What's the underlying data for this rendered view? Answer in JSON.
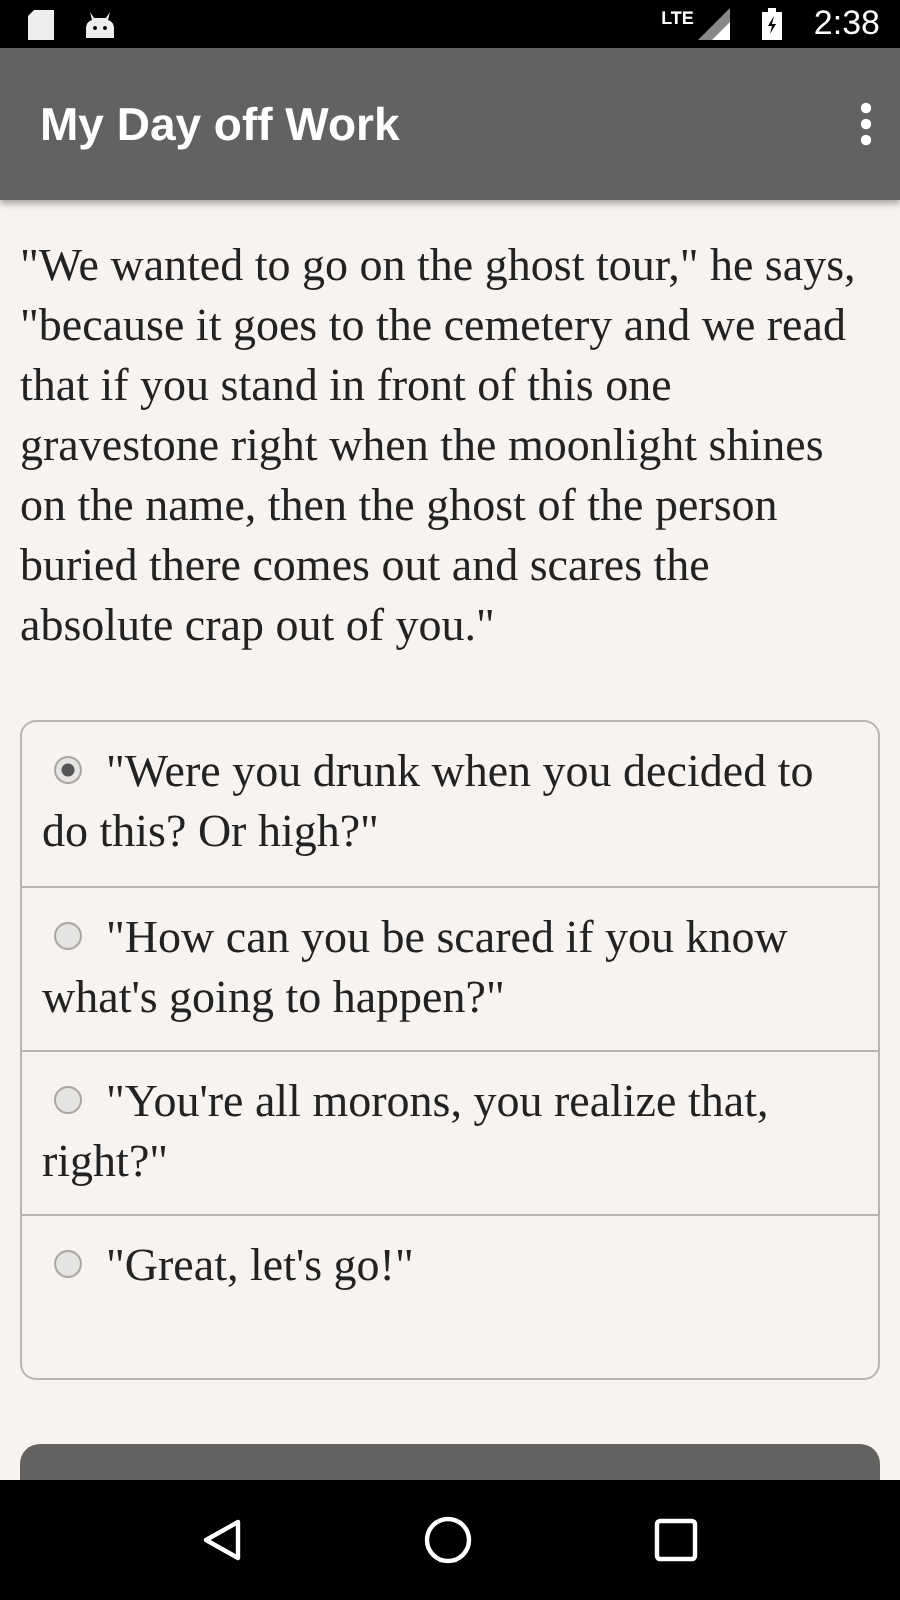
{
  "status_bar": {
    "network": "LTE",
    "time": "2:38"
  },
  "app_bar": {
    "title": "My Day off Work"
  },
  "story": "\"We wanted to go on the ghost tour,\" he says, \"because it goes to the cemetery and we read that if you stand in front of this one gravestone right when the moonlight shines on the name, then the ghost of the person buried there comes out and scares the absolute crap out of you.\"",
  "choices": [
    {
      "label": "\"Were you drunk when you decided to do this? Or high?\"",
      "selected": true
    },
    {
      "label": "\"How can you be scared if you know what's going to happen?\"",
      "selected": false
    },
    {
      "label": "\"You're all morons, you realize that, right?\"",
      "selected": false
    },
    {
      "label": "\"Great, let's go!\"",
      "selected": false
    }
  ]
}
